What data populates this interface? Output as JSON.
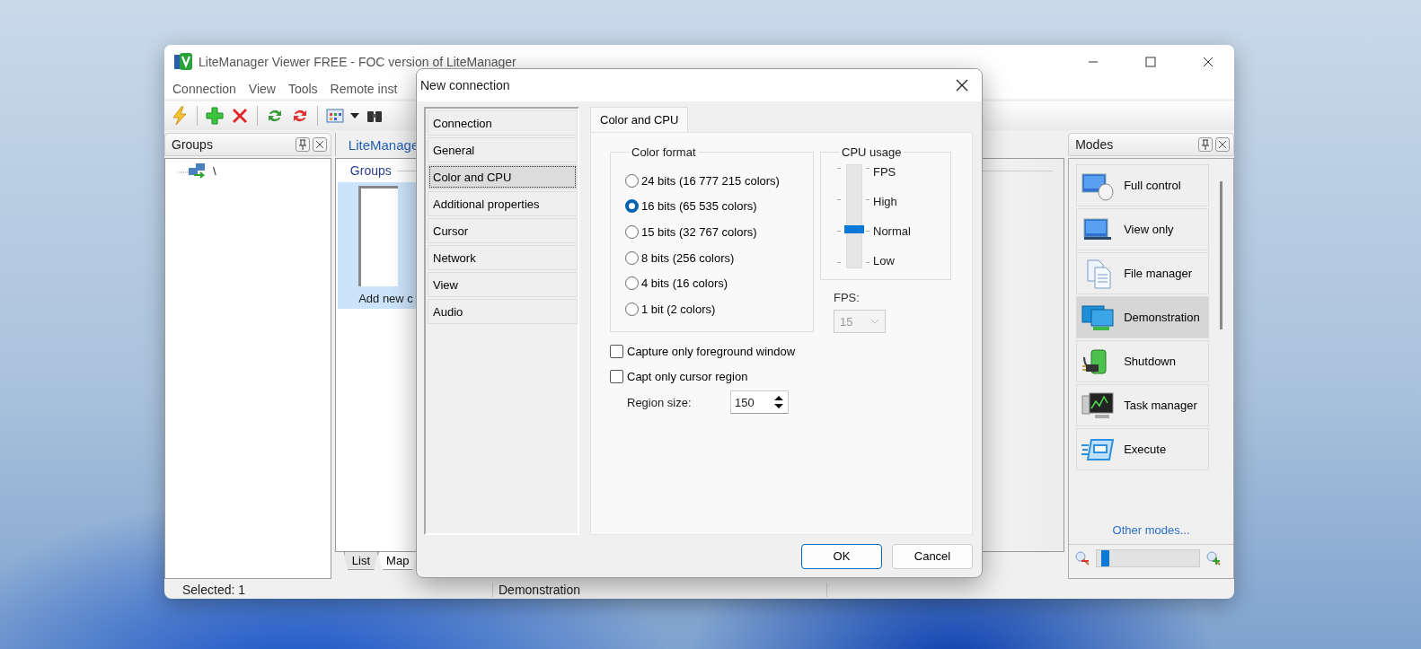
{
  "window": {
    "title": "LiteManager Viewer FREE - FOC version of LiteManager",
    "menu": [
      "Connection",
      "View",
      "Tools",
      "Remote inst"
    ]
  },
  "groups_panel": {
    "title": "Groups",
    "tree": [
      {
        "label": "\\"
      }
    ]
  },
  "center": {
    "tab": "LiteManage",
    "section": "Groups",
    "items": [
      {
        "label": "Add new c",
        "selected": true
      }
    ],
    "bottom_tabs": [
      {
        "label": "List",
        "selected": false
      },
      {
        "label": "Map",
        "selected": true
      }
    ]
  },
  "modes_panel": {
    "title": "Modes",
    "items": [
      {
        "label": "Full control",
        "selected": false
      },
      {
        "label": "View only",
        "selected": false
      },
      {
        "label": "File manager",
        "selected": false
      },
      {
        "label": "Demonstration",
        "selected": true
      },
      {
        "label": "Shutdown",
        "selected": false
      },
      {
        "label": "Task manager",
        "selected": false
      },
      {
        "label": "Execute",
        "selected": false
      }
    ],
    "link": "Other modes...",
    "zoom": {
      "level": 0.05
    }
  },
  "status_bar": [
    "Selected: 1",
    "Demonstration"
  ],
  "dialog": {
    "title": "New connection",
    "nav": [
      {
        "label": "Connection",
        "selected": false
      },
      {
        "label": "General",
        "selected": false
      },
      {
        "label": "Color and CPU",
        "selected": true
      },
      {
        "label": "Additional properties",
        "selected": false
      },
      {
        "label": "Cursor",
        "selected": false
      },
      {
        "label": "Network",
        "selected": false
      },
      {
        "label": "View",
        "selected": false
      },
      {
        "label": "Audio",
        "selected": false
      }
    ],
    "tabs": [
      {
        "label": "Color and CPU",
        "selected": true
      }
    ],
    "color_format": {
      "title": "Color format",
      "options": [
        {
          "label": "24 bits (16 777 215 colors)",
          "selected": false
        },
        {
          "label": "16 bits (65 535 colors)",
          "selected": true
        },
        {
          "label": "15 bits (32 767 colors)",
          "selected": false
        },
        {
          "label": "8 bits (256 colors)",
          "selected": false
        },
        {
          "label": "4 bits (16 colors)",
          "selected": false
        },
        {
          "label": "1 bit (2 colors)",
          "selected": false
        }
      ]
    },
    "cpu_usage": {
      "title": "CPU usage",
      "levels": [
        "FPS",
        "High",
        "Normal",
        "Low"
      ],
      "level": 0.35
    },
    "fps": {
      "label": "FPS:",
      "value": "15",
      "disabled": true
    },
    "checkboxes": [
      {
        "label": "Capture only foreground window",
        "checked": false
      },
      {
        "label": "Capt only cursor region",
        "checked": false
      }
    ],
    "region_size": {
      "label": "Region size:",
      "value": "150"
    },
    "buttons": [
      "OK",
      "Cancel"
    ]
  }
}
